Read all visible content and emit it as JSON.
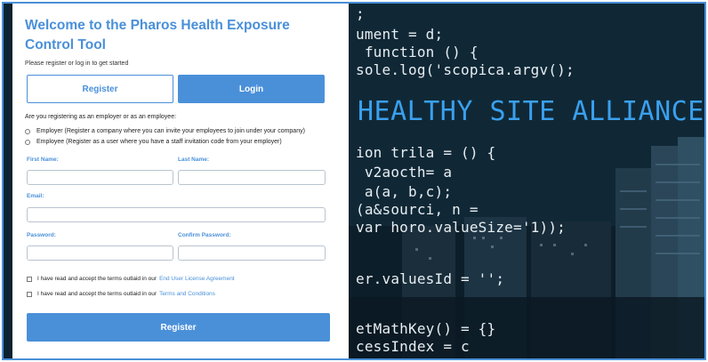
{
  "card": {
    "title": "Welcome to the Pharos Health Exposure Control Tool",
    "subtitle": "Please register or log in to get started",
    "tabs": {
      "register": "Register",
      "login": "Login"
    },
    "question": "Are you registering as an employer or as an employee:",
    "options": [
      "Employer (Register a company where you can invite your employees to join under your company)",
      "Employee (Register as a user where you have a staff invitation code from your employer)"
    ],
    "fields": {
      "first_name": {
        "label": "First Name:",
        "value": ""
      },
      "last_name": {
        "label": "Last Name:",
        "value": ""
      },
      "email": {
        "label": "Email:",
        "value": ""
      },
      "password": {
        "label": "Password:",
        "value": ""
      },
      "confirm_password": {
        "label": "Confirm Password:",
        "value": ""
      }
    },
    "terms": [
      {
        "text": "I have read and accept the terms outlaid in our",
        "link": "End User License Agreement"
      },
      {
        "text": "I have read and accept the terms outlaid in our",
        "link": "Terms and Conditions"
      }
    ],
    "submit": "Register"
  },
  "background": {
    "hero": "HEALTHY SITE ALLIANCE",
    "code_lines": [
      ";",
      "ument = d;",
      " function () {",
      "sole.log('scopica.argv();",
      "ion trila = () {",
      " v2aocth= a",
      " a(a, b,c);",
      "(a&sourci, n =",
      "var horo.valueSize='1));",
      "er.valuesId = '';",
      "etMathKey() = {}",
      "cessIndex = c"
    ]
  },
  "colors": {
    "accent": "#4a90d9",
    "hero": "#3aa0ee"
  }
}
